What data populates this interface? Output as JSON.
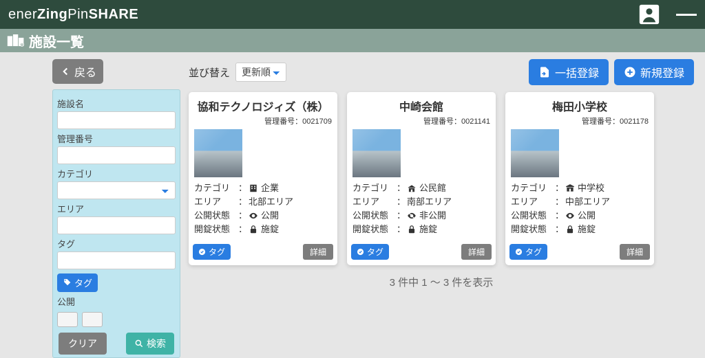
{
  "brand": {
    "p1": "ener",
    "p2": "Zing",
    "p3": "Pin",
    "p4": "SHARE"
  },
  "page_title": "施設一覧",
  "back_label": "戻る",
  "filters": {
    "name_label": "施設名",
    "num_label": "管理番号",
    "cat_label": "カテゴリ",
    "area_label": "エリア",
    "tag_label": "タグ",
    "tag_btn": "タグ",
    "public_label": "公開",
    "clear_btn": "クリア",
    "search_btn": "検索"
  },
  "sort": {
    "label": "並び替え",
    "selected": "更新順"
  },
  "actions": {
    "bulk": "一括登録",
    "new": "新規登録"
  },
  "labels": {
    "mgmt_prefix": "管理番号：",
    "category": "カテゴリ",
    "area": "エリア",
    "public_state": "公開状態",
    "lock_state": "開錠状態",
    "tag_pill": "タグ",
    "detail": "詳細",
    "colon": "："
  },
  "cards": [
    {
      "title": "協和テクノロジィズ（株）",
      "num": "0021709",
      "category": "企業",
      "area": "北部エリア",
      "pub": "公開",
      "pub_visible": true,
      "lock": "施錠"
    },
    {
      "title": "中崎会館",
      "num": "0021141",
      "category": "公民館",
      "area": "南部エリア",
      "pub": "非公開",
      "pub_visible": false,
      "lock": "施錠"
    },
    {
      "title": "梅田小学校",
      "num": "0021178",
      "category": "中学校",
      "area": "中部エリア",
      "pub": "公開",
      "pub_visible": true,
      "lock": "施錠"
    }
  ],
  "result_text": "3 件中 1 〜 3 件を表示"
}
